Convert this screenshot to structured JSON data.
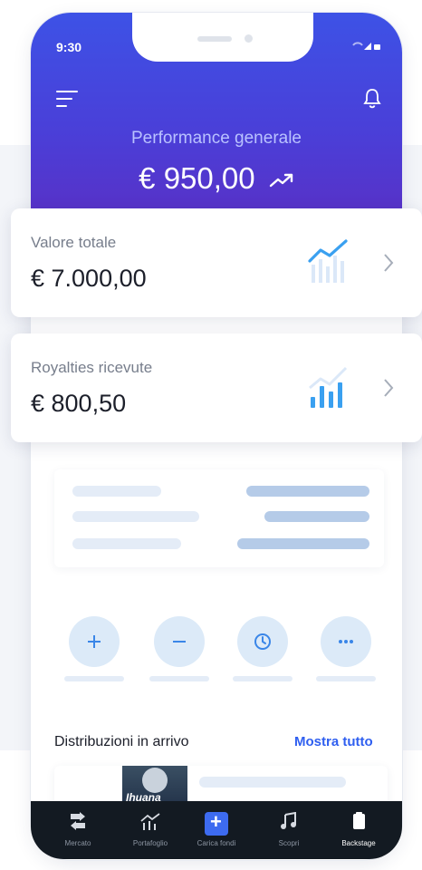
{
  "status_bar": {
    "time": "9:30"
  },
  "header": {
    "performance_label": "Performance generale",
    "performance_value": "€ 950,00"
  },
  "cards": [
    {
      "label": "Valore totale",
      "value": "€ 7.000,00",
      "icon": "line-chart-icon"
    },
    {
      "label": "Royalties ricevute",
      "value": "€ 800,50",
      "icon": "bar-chart-icon"
    }
  ],
  "quick_actions": [
    {
      "icon": "plus-icon"
    },
    {
      "icon": "minus-icon"
    },
    {
      "icon": "clock-icon"
    },
    {
      "icon": "more-icon"
    }
  ],
  "distributions": {
    "title": "Distribuzioni in arrivo",
    "show_all": "Mostra tutto",
    "album_title": "Ihuana"
  },
  "bottom_nav": [
    {
      "label": "Mercato",
      "icon": "transfer-icon"
    },
    {
      "label": "Portafoglio",
      "icon": "portfolio-chart-icon"
    },
    {
      "label": "Carica fondi",
      "icon": "add-funds-icon"
    },
    {
      "label": "Scopri",
      "icon": "music-note-icon"
    },
    {
      "label": "Backstage",
      "icon": "backstage-icon"
    }
  ],
  "colors": {
    "header_start": "#3d52e6",
    "header_end": "#5a2fc4",
    "accent": "#2f5ff0",
    "nav_bg": "#131a22"
  }
}
